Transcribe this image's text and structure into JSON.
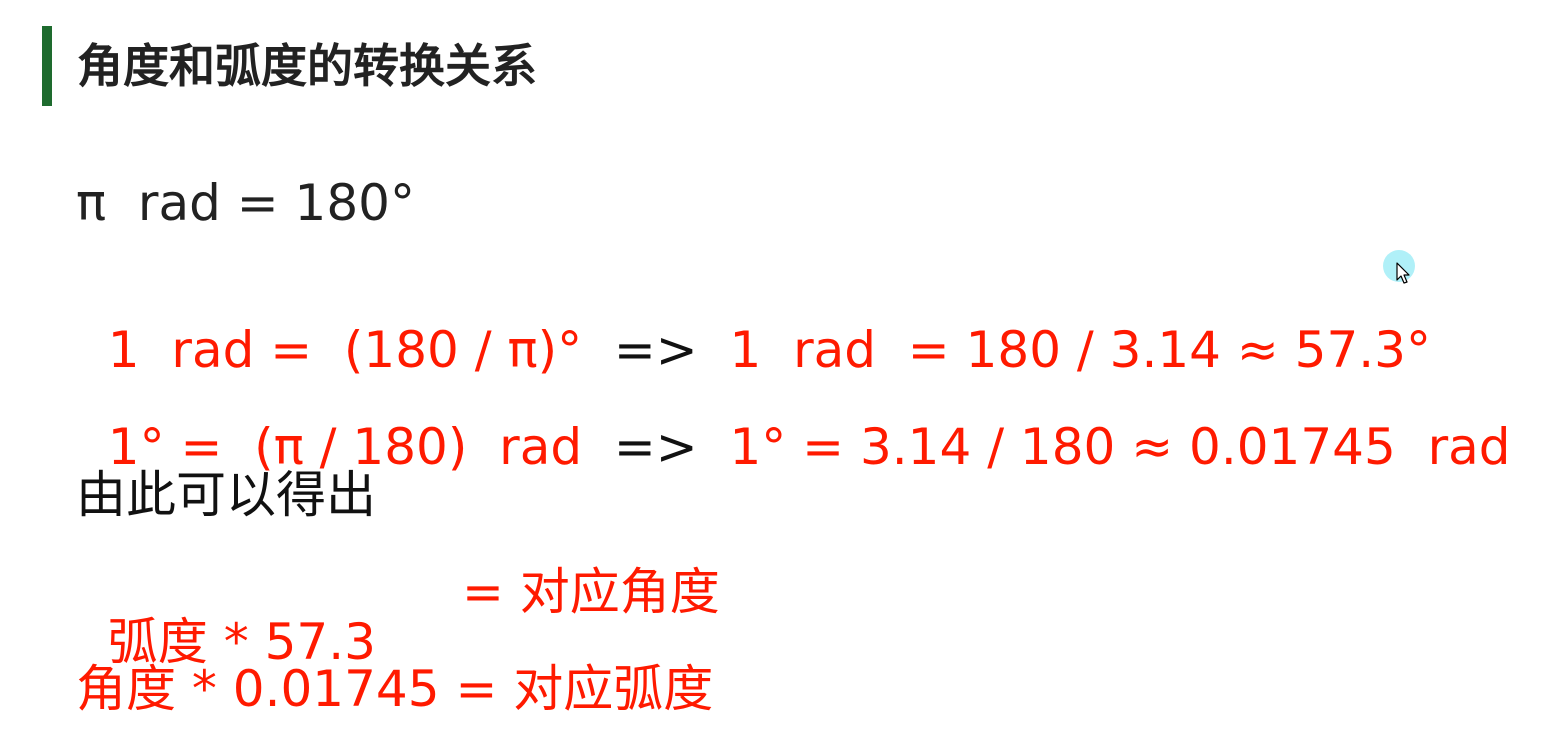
{
  "header": {
    "title": "角度和弧度的转换关系"
  },
  "lines": {
    "l1": "π  rad = 180°",
    "l2a": "1  rad =  (180 / π)°  ",
    "l2arrow": "=>",
    "l2b": "  1  rad  = 180 / 3.14 ≈ 57.3°",
    "l3a": "1° =  (π / 180)  rad  ",
    "l3arrow": "=>",
    "l3b": "  1° = 3.14 / 180 ≈ 0.01745  rad",
    "l4": "由此可以得出",
    "l5a": "弧度 * 57.3",
    "l5b": "= 对应角度",
    "l6": "角度 * 0.01745 = 对应弧度"
  },
  "colors": {
    "accent_bar": "#1e6b2e",
    "emphasis_text": "#ff1a00",
    "body_text": "#222222"
  },
  "icons": {
    "cursor": "cursor-arrow-icon"
  }
}
